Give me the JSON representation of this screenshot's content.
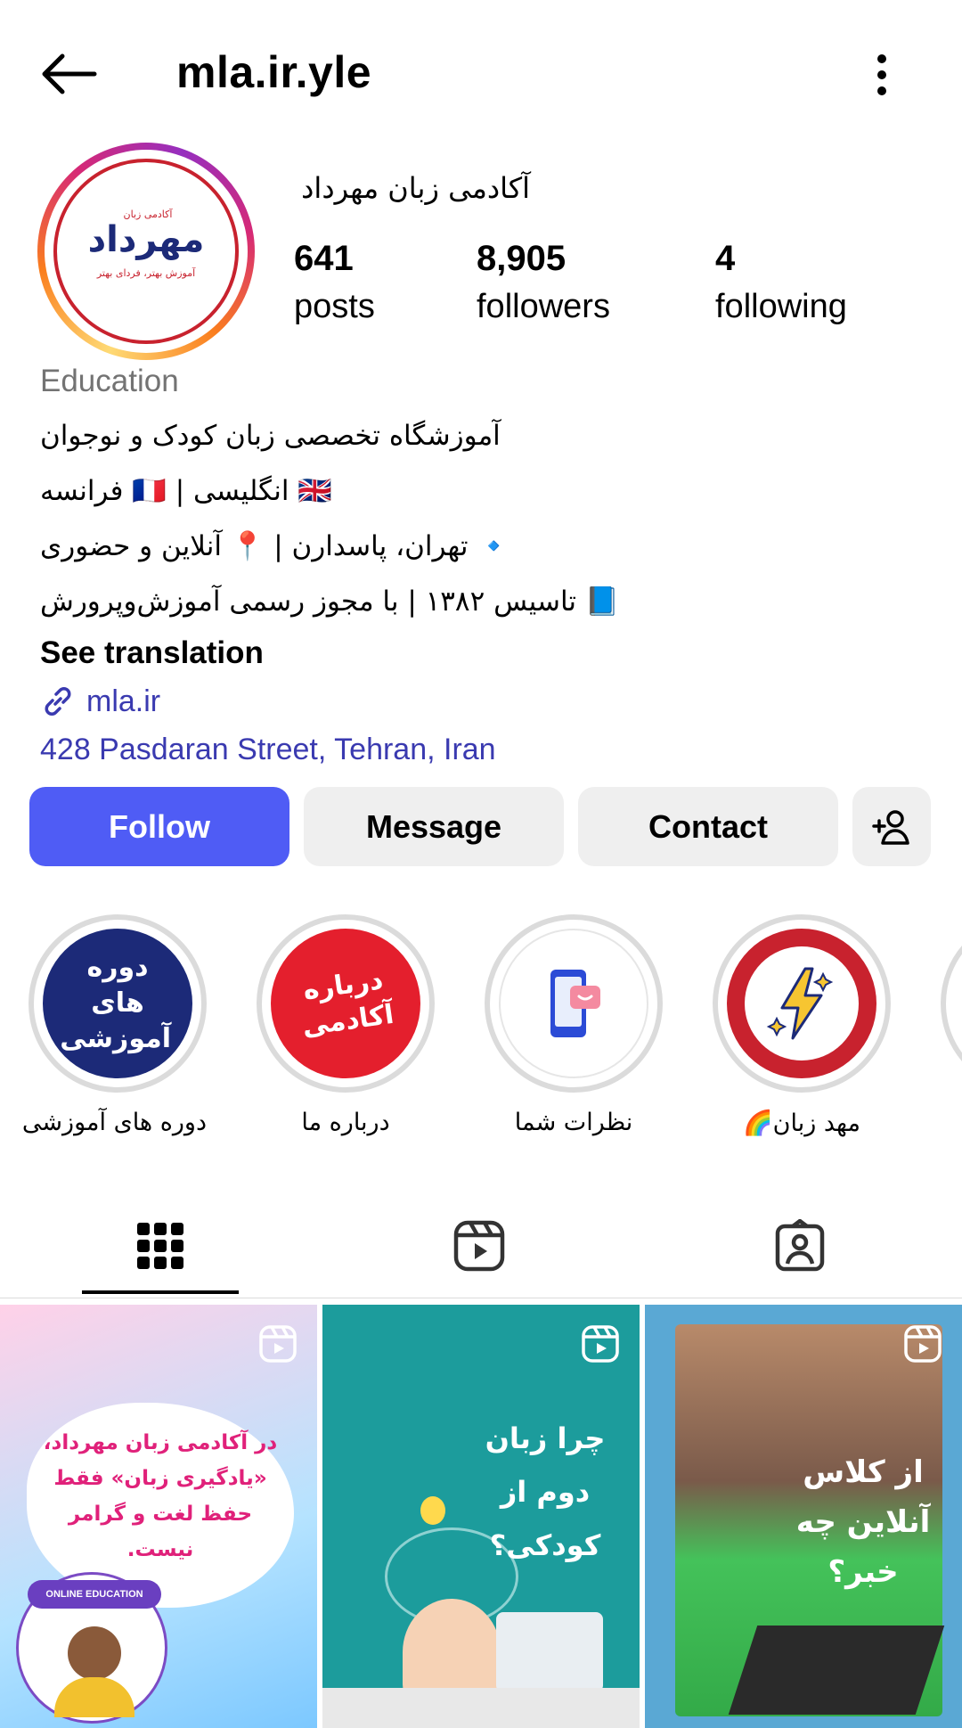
{
  "header": {
    "username": "mla.ir.yle"
  },
  "profile": {
    "display_name": "آکادمی زبان مهرداد",
    "logo_text": "مهرداد",
    "logo_sub": "آموزش بهتر، فردای بهتر",
    "logo_top": "آکادمی زبان",
    "stats": [
      {
        "value": "641",
        "label": "posts"
      },
      {
        "value": "8,905",
        "label": "followers"
      },
      {
        "value": "4",
        "label": "following"
      }
    ],
    "category": "Education",
    "bio": [
      "آموزشگاه تخصصی زبان کودک و نوجوان",
      "🇬🇧 انگلیسی | 🇫🇷 فرانسه",
      "🔹 تهران، پاسدارن | 📍 آنلاین و حضوری",
      "📘 تاسیس ۱۳۸۲ | با مجوز رسمی آموزش‌وپرورش"
    ],
    "see_translation": "See translation",
    "link": "mla.ir",
    "address": "428 Pasdaran Street, Tehran, Iran"
  },
  "actions": {
    "follow": "Follow",
    "message": "Message",
    "contact": "Contact"
  },
  "highlights": [
    {
      "label": "دوره های آموزشی",
      "cover_text": "دوره های آموزشی",
      "color": "#1c2a78"
    },
    {
      "label": "درباره ما",
      "cover_text": "درباره آکادمی",
      "color": "#e41f2d"
    },
    {
      "label": "نظرات شما",
      "cover_text": "",
      "color": "#ffffff"
    },
    {
      "label": "مهد زبان🌈",
      "cover_text": "",
      "color": "#c8222e"
    }
  ],
  "posts": [
    {
      "text": "در آکادمی زبان مهرداد، «یادگیری زبان» فقط حفظ لغت و گرامر نیست.",
      "badge": "ONLINE EDUCATION"
    },
    {
      "text": "چرا زبان دوم از کودکی؟"
    },
    {
      "text": "از کلاس آنلاین چه خبر؟"
    }
  ],
  "colors": {
    "follow": "#4f5cf5",
    "link": "#3a3ab0"
  }
}
